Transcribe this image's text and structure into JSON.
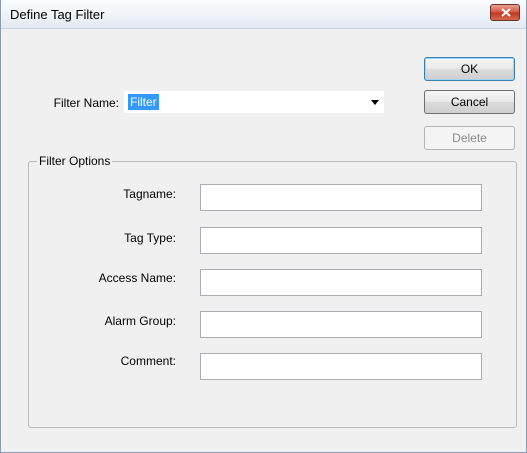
{
  "window": {
    "title": "Define Tag Filter"
  },
  "filter_name": {
    "label": "Filter Name:",
    "value": "Filter"
  },
  "buttons": {
    "ok": "OK",
    "cancel": "Cancel",
    "delete": "Delete"
  },
  "filter_options": {
    "legend": "Filter Options",
    "fields": [
      {
        "label": "Tagname:",
        "value": ""
      },
      {
        "label": "Tag Type:",
        "value": ""
      },
      {
        "label": "Access Name:",
        "value": ""
      },
      {
        "label": "Alarm Group:",
        "value": ""
      },
      {
        "label": "Comment:",
        "value": ""
      }
    ]
  },
  "icons": {
    "close": "close-icon",
    "dropdown": "chevron-down-icon"
  }
}
